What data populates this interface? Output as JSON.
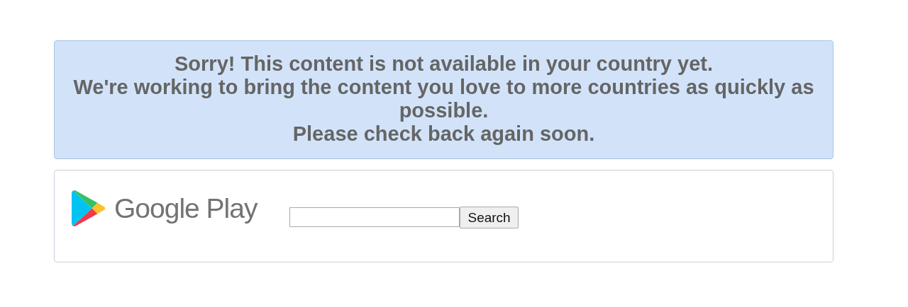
{
  "notice": {
    "lines": [
      "Sorry! This content is not available in your country yet.",
      "We're working to bring the content you love to more countries as quickly as possible.",
      "Please check back again soon."
    ]
  },
  "header": {
    "logo_text": "Google Play",
    "search": {
      "button": "Search"
    }
  }
}
